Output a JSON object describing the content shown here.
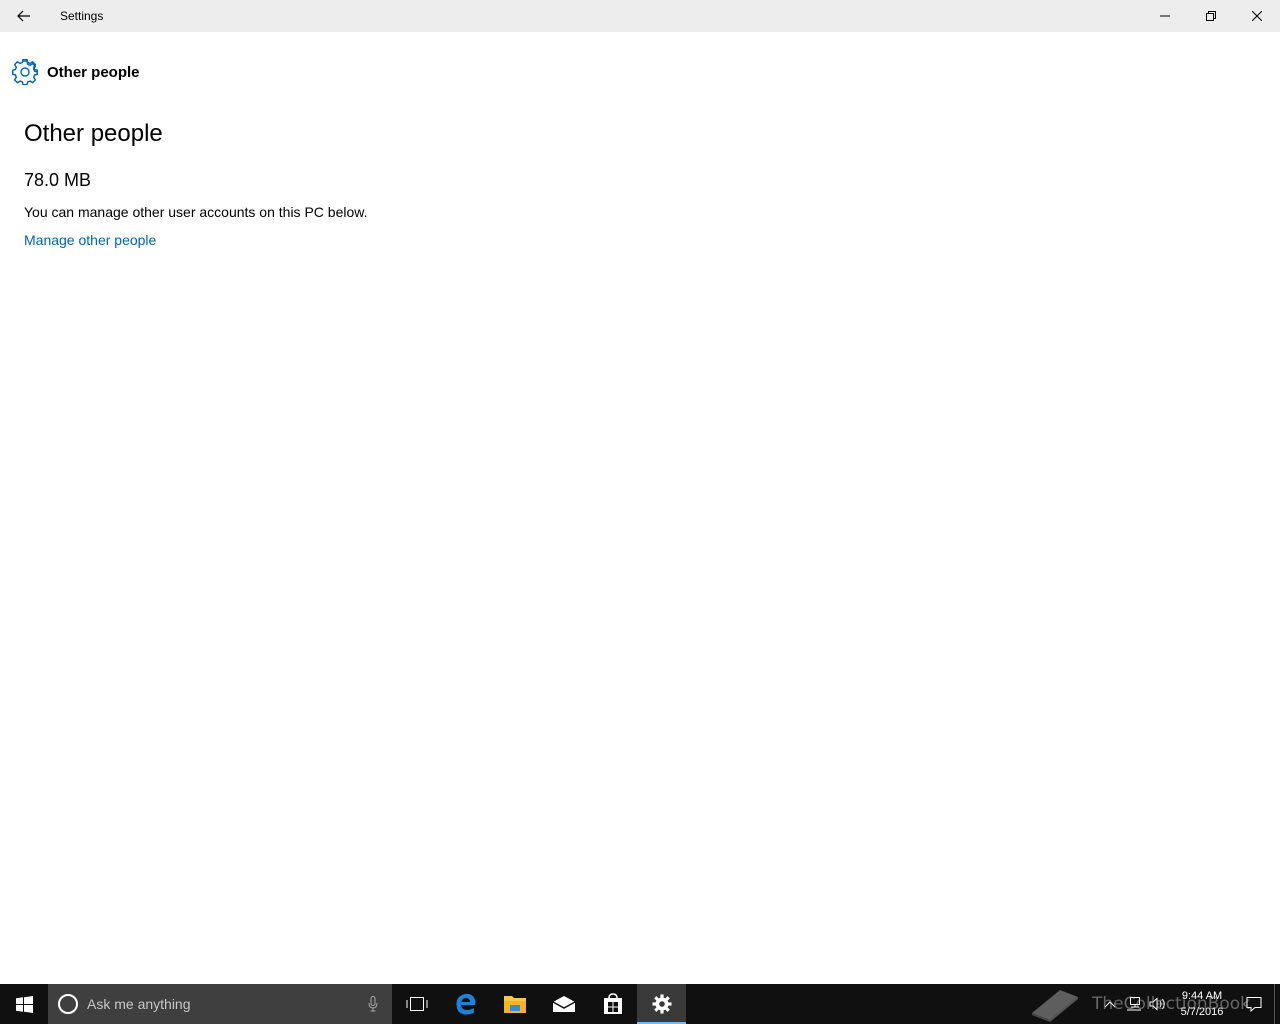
{
  "window": {
    "title": "Settings"
  },
  "header": {
    "icon": "gear-icon",
    "title": "Other people"
  },
  "content": {
    "section_title": "Other people",
    "size": "78.0 MB",
    "description": "You can manage other user accounts on this PC below.",
    "link": "Manage other people"
  },
  "taskbar": {
    "search_placeholder": "Ask me anything",
    "apps": [
      "task-view-icon",
      "edge-icon",
      "file-explorer-icon",
      "mail-icon",
      "store-icon",
      "settings-icon"
    ],
    "active_app": "settings-icon",
    "clock_time": "9:44 AM",
    "clock_date": "5/7/2016"
  },
  "watermark": {
    "text": "TheCollectionBook"
  },
  "colors": {
    "accent": "#0063b1",
    "taskbar": "#101010",
    "search": "#3f3f3f",
    "titlebar": "#ededed"
  }
}
